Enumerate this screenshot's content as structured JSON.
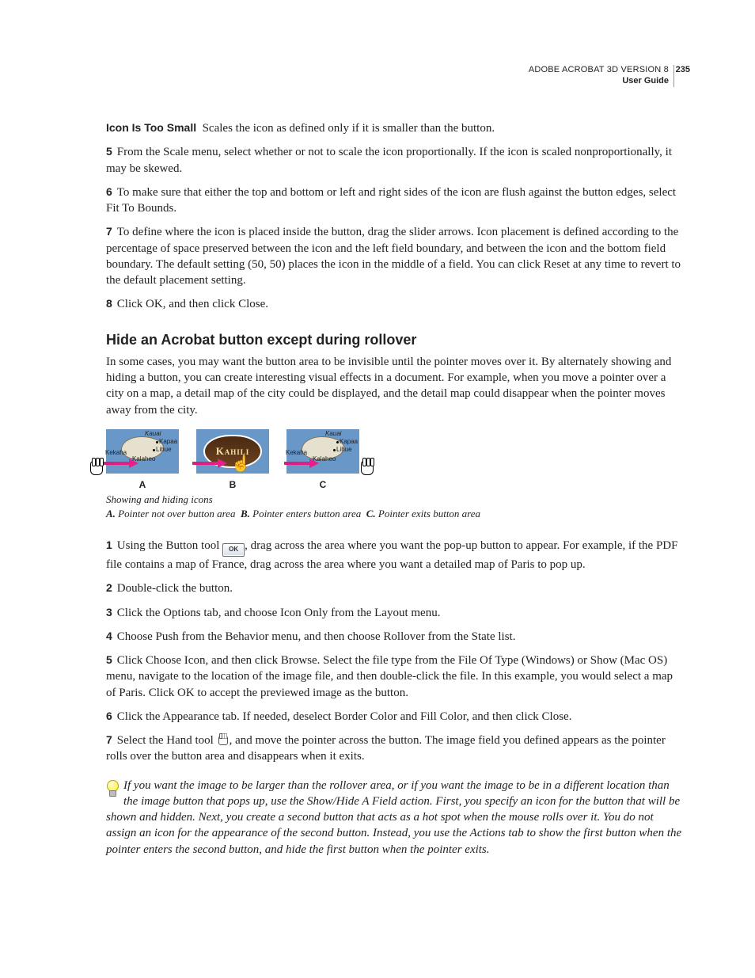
{
  "header": {
    "line1": "ADOBE ACROBAT 3D VERSION 8",
    "line2": "User Guide",
    "page": "235"
  },
  "defA": {
    "label": "Icon Is Too Small",
    "text": "Scales the icon as defined only if it is smaller than the button."
  },
  "s5": {
    "num": "5",
    "text": "From the Scale menu, select whether or not to scale the icon proportionally. If the icon is scaled nonproportionally, it may be skewed."
  },
  "s6": {
    "num": "6",
    "text": "To make sure that either the top and bottom or left and right sides of the icon are flush against the button edges, select Fit To Bounds."
  },
  "s7": {
    "num": "7",
    "text": "To define where the icon is placed inside the button, drag the slider arrows. Icon placement is defined according to the percentage of space preserved between the icon and the left field boundary, and between the icon and the bottom field boundary. The default setting (50, 50) places the icon in the middle of a field. You can click Reset at any time to revert to the default placement setting."
  },
  "s8": {
    "num": "8",
    "text": "Click OK, and then click Close."
  },
  "heading": "Hide an Acrobat button except during rollover",
  "intro": "In some cases, you may want the button area to be invisible until the pointer moves over it. By alternately showing and hiding a button, you can create interesting visual effects in a document. For example, when you move a pointer over a city on a map, a detail map of the city could be displayed, and the detail map could disappear when the pointer moves away from the city.",
  "fig": {
    "letters": {
      "A": "A",
      "B": "B",
      "C": "C"
    },
    "captionTitle": "Showing and hiding icons",
    "kA": "A.",
    "kAt": "Pointer not over button area",
    "kB": "B.",
    "kBt": "Pointer enters button area",
    "kC": "C.",
    "kCt": "Pointer exits button area",
    "overlayText": "Kahili",
    "map": {
      "kauai": "Kauai",
      "kapaa": "Kapaa",
      "lihue": "Lihue",
      "kekaha": "Kekaha",
      "kalaheo": "Kalaheo"
    }
  },
  "h1": {
    "num": "1",
    "pre": "Using the Button tool ",
    "btn": "OK",
    "post": ", drag across the area where you want the pop-up button to appear. For example, if the PDF file contains a map of France, drag across the area where you want a detailed map of Paris to pop up."
  },
  "h2": {
    "num": "2",
    "text": "Double-click the button."
  },
  "h3": {
    "num": "3",
    "text": "Click the Options tab, and choose Icon Only from the Layout menu."
  },
  "h4": {
    "num": "4",
    "text": "Choose Push from the Behavior menu, and then choose Rollover from the State list."
  },
  "h5": {
    "num": "5",
    "text": "Click Choose Icon, and then click Browse. Select the file type from the File Of Type (Windows) or Show (Mac OS) menu, navigate to the location of the image file, and then double-click the file. In this example, you would select a map of Paris. Click OK to accept the previewed image as the button."
  },
  "h6": {
    "num": "6",
    "text": "Click the Appearance tab. If needed, deselect Border Color and Fill Color, and then click Close."
  },
  "h7": {
    "num": "7",
    "pre": "Select the Hand tool ",
    "post": ", and move the pointer across the button. The image field you defined appears as the pointer rolls over the button area and disappears when it exits."
  },
  "tip": "If you want the image to be larger than the rollover area, or if you want the image to be in a different location than the image button that pops up, use the Show/Hide A Field action. First, you specify an icon for the button that will be shown and hidden. Next, you create a second button that acts as a hot spot when the mouse rolls over it. You do not assign an icon for the appearance of the second button. Instead, you use the Actions tab to show the first button when the pointer enters the second button, and hide the first button when the pointer exits."
}
